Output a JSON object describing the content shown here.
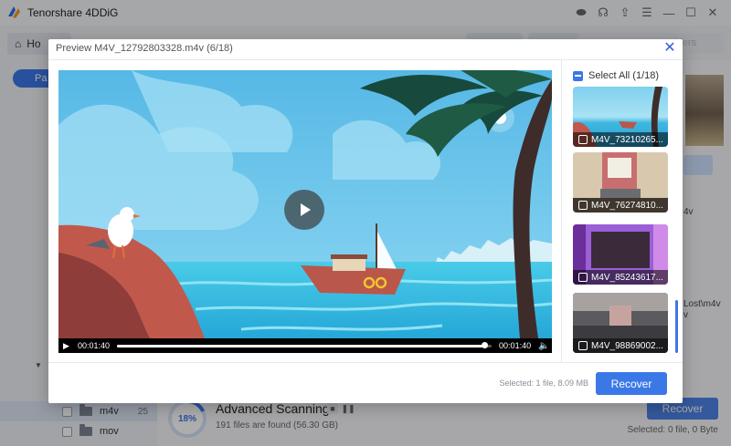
{
  "app": {
    "title": "Tenorshare 4DDiG",
    "home_tab": "Ho",
    "search_placeholder": "lders",
    "path_pill": "Pa"
  },
  "sidebar": {
    "rows": [
      {
        "label": "m4v",
        "count": "25"
      },
      {
        "label": "mov",
        "count": ""
      }
    ]
  },
  "background_panel": {
    "text_a": "4v",
    "text_b": "Lost\\m4v",
    "text_c": "v"
  },
  "scan": {
    "progress_text": "18%",
    "progress_fraction": 0.18,
    "title": "Advanced Scanning",
    "subtitle": "191 files are found (56.30 GB)",
    "recover_label": "Recover",
    "selected_text": "Selected: 0 file, 0 Byte"
  },
  "preview": {
    "title": "Preview M4V_12792803328.m4v (6/18)",
    "player": {
      "time_current": "00:01:40",
      "time_total": "00:01:40",
      "progress_fraction": 0.98
    },
    "select_all_label": "Select All (1/18)",
    "thumbnails": [
      {
        "name": "M4V_73210265..."
      },
      {
        "name": "M4V_76274810..."
      },
      {
        "name": "M4V_85243617..."
      },
      {
        "name": "M4V_98869002..."
      }
    ],
    "footer_selected": "Selected: 1 file, 8.09 MB",
    "recover_label": "Recover"
  },
  "colors": {
    "accent": "#3b78e7",
    "sky": "#5bc3ea",
    "sea": "#37bde0",
    "rock": "#c0594c"
  }
}
